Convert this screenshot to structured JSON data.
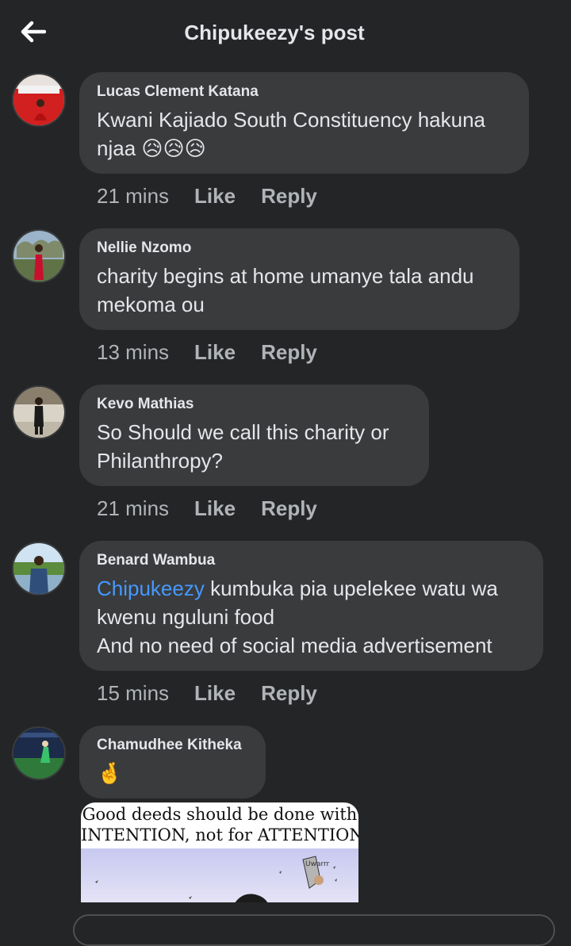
{
  "header": {
    "title": "Chipukeezy's post",
    "back_icon": "arrow-left-icon"
  },
  "comments": [
    {
      "author": "Lucas Clement Katana",
      "text": "Kwani Kajiado South Constituency hakuna",
      "text2": "njaa",
      "emoji": "😥😥😥",
      "time": "21 mins",
      "like": "Like",
      "reply": "Reply"
    },
    {
      "author": "Nellie Nzomo",
      "text": "charity begins at home umanye tala andu",
      "text2": "mekoma ou",
      "time": "13 mins",
      "like": "Like",
      "reply": "Reply"
    },
    {
      "author": "Kevo Mathias",
      "text": "So Should we call this charity or",
      "text2": "Philanthropy?",
      "time": "21 mins",
      "like": "Like",
      "reply": "Reply"
    },
    {
      "author": "Benard Wambua",
      "mention": "Chipukeezy",
      "text": " kumbuka pia upelekee watu wa",
      "text2": "kwenu nguluni food",
      "text3": "And no need of social media advertisement",
      "time": "15 mins",
      "like": "Like",
      "reply": "Reply"
    },
    {
      "author": "Chamudhee Kitheka",
      "emoji": "🤞"
    }
  ],
  "meme": {
    "line1": "Good deeds should be done with",
    "line2": "INTENTION, not for ATTENTION."
  },
  "colors": {
    "background": "#242526",
    "bubble": "#3a3b3c",
    "mention": "#4599ff",
    "muted": "#b0b3b8"
  }
}
